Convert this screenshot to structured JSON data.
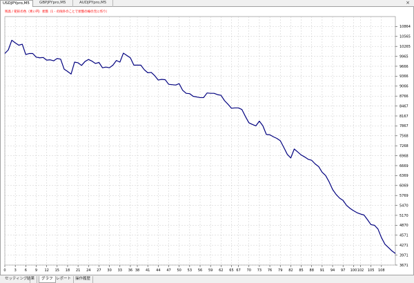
{
  "top_tabs": [
    "USDJPYpro,M5",
    "GBPJPYpro,M5",
    "AUDJPYpro,M5"
  ],
  "active_top_tab": 0,
  "close_glyph": "×",
  "bottom_tabs": [
    "セッティング",
    "結果",
    "グラフ",
    "レポート",
    "操作履歴"
  ],
  "active_bottom_tab": 2,
  "colors": {
    "line": "#00007f",
    "legend_text": "#ff0000",
    "grid": "#c8c8c8"
  },
  "chart_data": {
    "type": "line",
    "title": "",
    "xlabel": "",
    "ylabel": "",
    "legend_text": "残高 / 矩形の色（青い円）状態（1 - の除外のことで状態の線の元に作り）",
    "legend_placement": "top-left",
    "grid": true,
    "ylim": [
      3671,
      11164
    ],
    "xlim": [
      0,
      112
    ],
    "y_ticks": [
      "10864",
      "10565",
      "10265",
      "9965",
      "9666",
      "9366",
      "9066",
      "8766",
      "8467",
      "8167",
      "7867",
      "7568",
      "7268",
      "6968",
      "6669",
      "6369",
      "6069",
      "5769",
      "5470",
      "5170",
      "4870",
      "4571",
      "4271",
      "3971",
      "3671"
    ],
    "x_ticks": [
      "0",
      "3",
      "6",
      "9",
      "12",
      "15",
      "18",
      "21",
      "24",
      "27",
      "30",
      "33",
      "36",
      "38",
      "41",
      "44",
      "47",
      "50",
      "53",
      "56",
      "59",
      "62",
      "65",
      "67",
      "70",
      "73",
      "76",
      "79",
      "82",
      "85",
      "88",
      "91",
      "94",
      "97",
      "100",
      "102",
      "105",
      "108"
    ],
    "series": [
      {
        "name": "",
        "color": "#00007f",
        "x": [
          0,
          1,
          2,
          3,
          4,
          5,
          6,
          7,
          8,
          9,
          10,
          11,
          12,
          13,
          14,
          15,
          16,
          17,
          18,
          19,
          20,
          21,
          22,
          23,
          24,
          25,
          26,
          27,
          28,
          29,
          30,
          31,
          32,
          33,
          34,
          35,
          36,
          37,
          38,
          39,
          40,
          41,
          42,
          43,
          44,
          45,
          46,
          47,
          48,
          49,
          50,
          51,
          52,
          53,
          54,
          55,
          56,
          57,
          58,
          59,
          60,
          61,
          62,
          63,
          64,
          65,
          66,
          67,
          68,
          69,
          70,
          71,
          72,
          73,
          74,
          75,
          76,
          77,
          78,
          79,
          80,
          81,
          82,
          83,
          84,
          85,
          86,
          87,
          88,
          89,
          90,
          91,
          92,
          93,
          94,
          95,
          96,
          97,
          98,
          99,
          100,
          101,
          102,
          103,
          104,
          105,
          106,
          107,
          108,
          109,
          110,
          111,
          112
        ],
        "y": [
          10050,
          10160,
          10450,
          10370,
          10300,
          10330,
          10020,
          10050,
          10050,
          9940,
          9920,
          9930,
          9850,
          9860,
          9830,
          9900,
          9880,
          9580,
          9510,
          9430,
          9790,
          9770,
          9690,
          9810,
          9870,
          9820,
          9750,
          9780,
          9620,
          9640,
          9620,
          9700,
          9840,
          9790,
          10060,
          9990,
          9920,
          9700,
          9700,
          9700,
          9560,
          9470,
          9480,
          9380,
          9250,
          9270,
          9260,
          9120,
          9110,
          9100,
          9140,
          8940,
          8850,
          8840,
          8760,
          8740,
          8720,
          8720,
          8860,
          8850,
          8850,
          8810,
          8790,
          8630,
          8520,
          8400,
          8410,
          8410,
          8360,
          8150,
          7960,
          7910,
          7870,
          8010,
          7870,
          7610,
          7600,
          7540,
          7490,
          7420,
          7220,
          7010,
          6900,
          7170,
          7080,
          6990,
          6930,
          6860,
          6830,
          6720,
          6640,
          6470,
          6370,
          6180,
          5950,
          5800,
          5690,
          5620,
          5470,
          5380,
          5310,
          5250,
          5210,
          5180,
          5040,
          4890,
          4870,
          4760,
          4500,
          4300,
          4200,
          4100,
          4020
        ]
      }
    ]
  }
}
